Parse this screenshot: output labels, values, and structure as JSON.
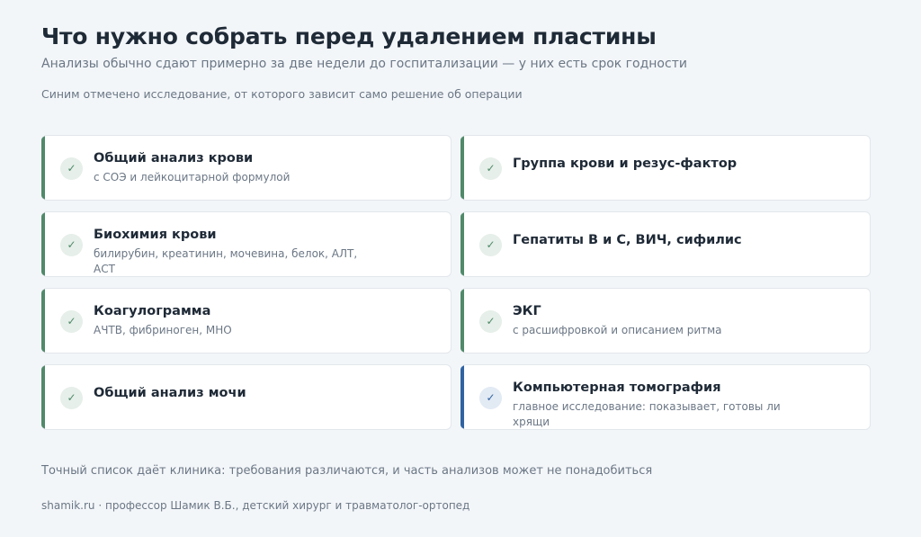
{
  "header": {
    "title": "Что нужно собрать перед удалением пластины",
    "subtitle": "Анализы обычно сдают примерно за две недели до госпитализации — у них есть срок годности",
    "legend_note": "Синим отмечено исследование, от которого зависит само решение об операции"
  },
  "colors": {
    "default_accent": "#4f8a6a",
    "primary_accent": "#2f63a3"
  },
  "checklist": [
    {
      "title": "Общий анализ крови",
      "sub": "с СОЭ и лейкоцитарной формулой",
      "primary": false,
      "icon": "check-icon"
    },
    {
      "title": "Группа крови и резус-фактор",
      "sub": "",
      "primary": false,
      "icon": "check-icon"
    },
    {
      "title": "Биохимия крови",
      "sub": "билирубин, креатинин, мочевина, белок, АЛТ, АСТ",
      "primary": false,
      "icon": "check-icon"
    },
    {
      "title": "Гепатиты B и C, ВИЧ, сифилис",
      "sub": "",
      "primary": false,
      "icon": "check-icon"
    },
    {
      "title": "Коагулограмма",
      "sub": "АЧТВ, фибриноген, МНО",
      "primary": false,
      "icon": "check-icon"
    },
    {
      "title": "ЭКГ",
      "sub": "с расшифровкой и описанием ритма",
      "primary": false,
      "icon": "check-icon"
    },
    {
      "title": "Общий анализ мочи",
      "sub": "",
      "primary": false,
      "icon": "check-icon"
    },
    {
      "title": "Компьютерная томография",
      "sub": "главное исследование: показывает, готовы ли хрящи",
      "primary": true,
      "icon": "check-icon"
    }
  ],
  "check_glyph": "✓",
  "footer": {
    "note": "Точный список даёт клиника: требования различаются, и часть анализов может не понадобиться",
    "source": "shamik.ru · профессор Шамик В.Б., детский хирург и травматолог-ортопед"
  }
}
